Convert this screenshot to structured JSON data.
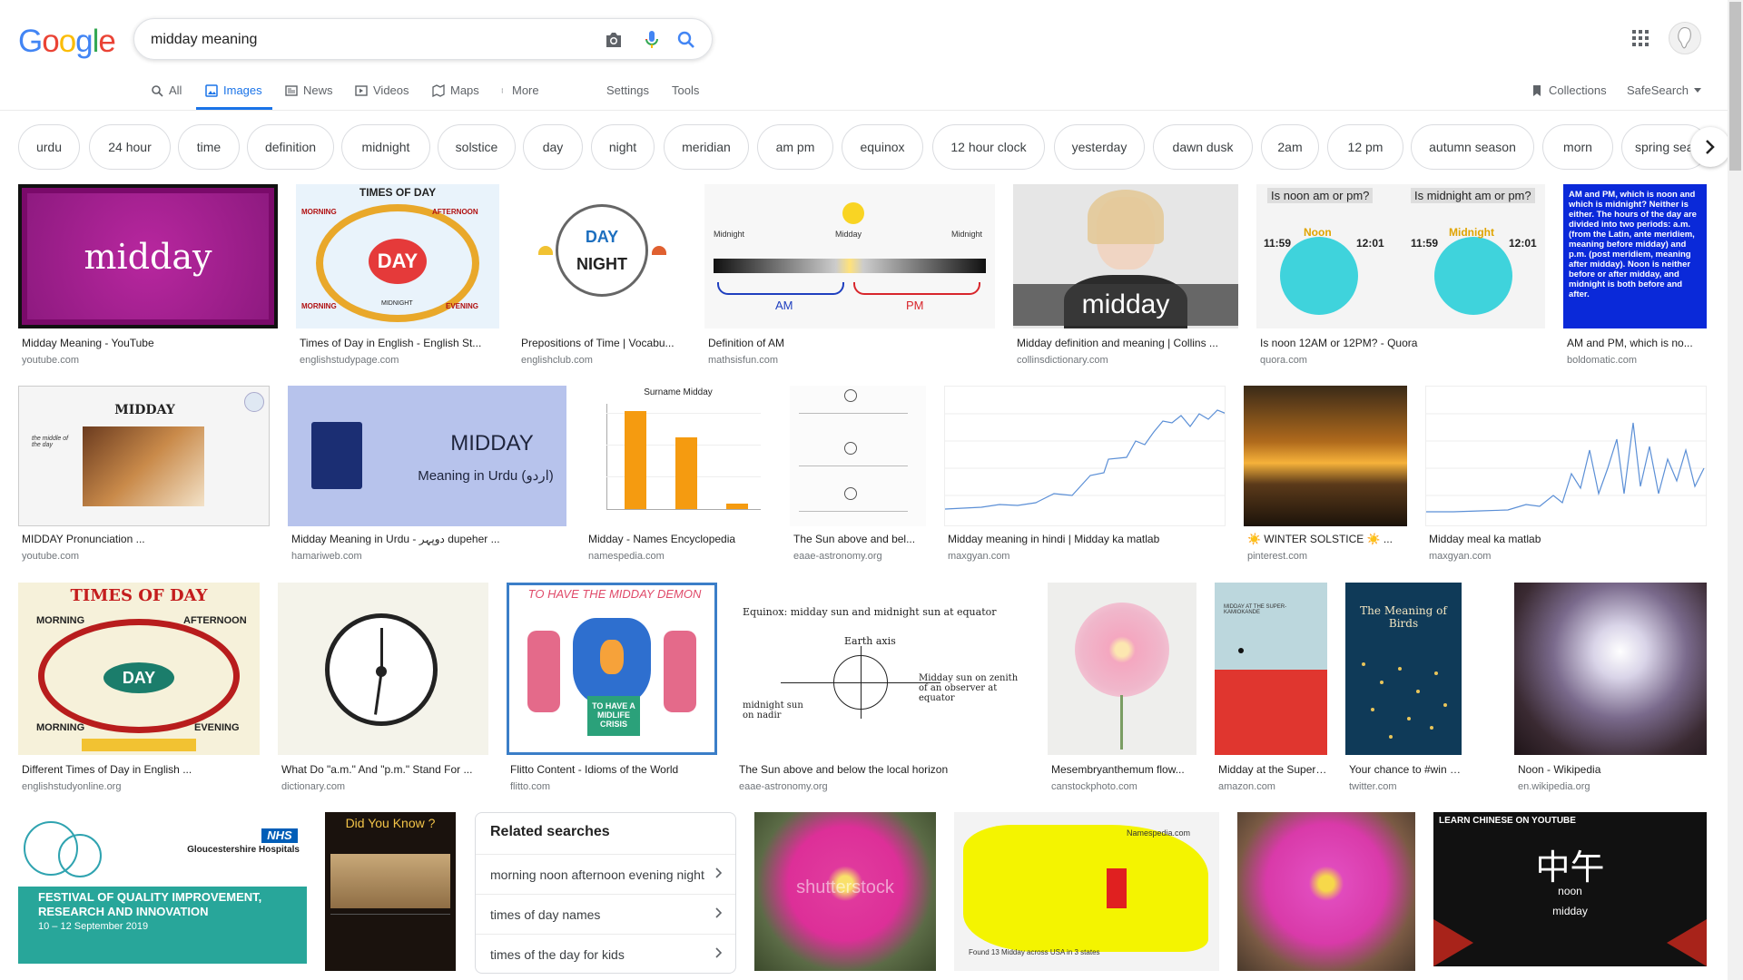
{
  "search": {
    "query": "midday meaning"
  },
  "tabs": {
    "all": "All",
    "images": "Images",
    "news": "News",
    "videos": "Videos",
    "maps": "Maps",
    "more": "More",
    "settings": "Settings",
    "tools": "Tools",
    "collections": "Collections",
    "safesearch": "SafeSearch"
  },
  "chips": [
    "urdu",
    "24 hour",
    "time",
    "definition",
    "midnight",
    "solstice",
    "day",
    "night",
    "meridian",
    "am pm",
    "equinox",
    "12 hour clock",
    "yesterday",
    "dawn dusk",
    "2am",
    "12 pm",
    "autumn season",
    "morn",
    "spring sea"
  ],
  "results": {
    "r1": {
      "caption": "Midday Meaning - YouTube",
      "domain": "youtube.com",
      "img_text": "midday"
    },
    "r2": {
      "caption": "Times of Day in English - English St...",
      "domain": "englishstudypage.com",
      "img_title": "TIMES OF DAY",
      "img_center": "DAY",
      "img_morning": "MORNING",
      "img_afternoon": "AFTERNOON",
      "img_evening": "EVENING",
      "img_night": "MIDNIGHT"
    },
    "r3": {
      "caption": "Prepositions of Time | Vocabu...",
      "domain": "englishclub.com",
      "img_day": "DAY",
      "img_night": "NIGHT"
    },
    "r4": {
      "caption": "Definition of AM",
      "domain": "mathsisfun.com",
      "img_am": "AM",
      "img_pm": "PM",
      "img_midnight": "Midnight",
      "img_midday": "Midday"
    },
    "r5": {
      "caption": "Midday definition and meaning | Collins ...",
      "domain": "collinsdictionary.com",
      "img_text": "midday"
    },
    "r6": {
      "caption": "Is noon 12AM or 12PM? - Quora",
      "domain": "quora.com",
      "img_q1": "Is noon am or pm?",
      "img_q2": "Is midnight am or pm?",
      "img_noon": "Noon",
      "img_midnight": "Midnight",
      "img_t1": "11:59",
      "img_t2": "12:01"
    },
    "r7": {
      "caption": "AM and PM, which is no...",
      "domain": "boldomatic.com",
      "img_text": "AM and PM, which is noon and which is midnight? Neither is either. The hours of the day are divided into two periods: a.m. (from the Latin, ante meridiem, meaning before midday) and p.m. (post meridiem, meaning after midday). Noon is neither before or after midday, and midnight is both before and after."
    },
    "r8": {
      "caption": "MIDDAY Pronunciation ...",
      "domain": "youtube.com",
      "img_title": "MIDDAY",
      "img_sub": "the middle of the day"
    },
    "r9": {
      "caption": "Midday Meaning in Urdu - دوپہر dupeher ...",
      "domain": "hamariweb.com",
      "img_title": "MIDDAY",
      "img_sub": "Meaning in Urdu (اردو)"
    },
    "r10": {
      "caption": "Midday - Names Encyclopedia",
      "domain": "namespedia.com",
      "img_title": "Surname Midday"
    },
    "r11": {
      "caption": "The Sun above and bel...",
      "domain": "eaae-astronomy.org"
    },
    "r12": {
      "caption": "Midday meaning in hindi | Midday ka matlab",
      "domain": "maxgyan.com"
    },
    "r13": {
      "caption": "☀️ WINTER SOLSTICE ☀️ ...",
      "domain": "pinterest.com"
    },
    "r14": {
      "caption": "Midday meal ka matlab",
      "domain": "maxgyan.com"
    },
    "r15": {
      "caption": "Different Times of Day in English ...",
      "domain": "englishstudyonline.org",
      "img_title": "TIMES OF DAY",
      "img_center": "DAY",
      "img_morning": "MORNING",
      "img_afternoon": "AFTERNOON",
      "img_evening": "EVENING"
    },
    "r16": {
      "caption": "What Do \"a.m.\" And \"p.m.\" Stand For ...",
      "domain": "dictionary.com"
    },
    "r17": {
      "caption": "Flitto Content - Idioms of the World",
      "domain": "flitto.com",
      "img_title": "TO HAVE THE MIDDAY DEMON",
      "img_sub": "TO HAVE A MIDLIFE CRISIS"
    },
    "r18": {
      "caption": "The Sun above and below the local horizon",
      "domain": "eaae-astronomy.org",
      "img_title": "Equinox: midday sun and midnight sun at equator",
      "img_axis": "Earth axis",
      "img_left": "midnight sun on nadir",
      "img_right": "Midday sun on zenith of an observer at equator"
    },
    "r19": {
      "caption": "Mesembryanthemum flow...",
      "domain": "canstockphoto.com"
    },
    "r20": {
      "caption": "Midday at the Super-K...",
      "domain": "amazon.com",
      "img_title": "MIDDAY AT THE SUPER-KAMIOKANDE"
    },
    "r21": {
      "caption": "Your chance to #win a...",
      "domain": "twitter.com",
      "img_title": "The Meaning of Birds"
    },
    "r22": {
      "caption": "Noon - Wikipedia",
      "domain": "en.wikipedia.org"
    },
    "r23": {
      "img_title": "FESTIVAL OF QUALITY IMPROVEMENT, RESEARCH AND INNOVATION",
      "img_date": "10 – 12 September 2019",
      "img_org": "Gloucestershire Hospitals",
      "img_nhs": "NHS"
    },
    "r24": {
      "img_title": "Did You Know ?"
    },
    "r25": {
      "img_text": "shutterstock"
    },
    "r26": {
      "img_text": "Namespedia.com",
      "img_sub": "Found 13 Midday across USA in 3 states"
    },
    "r28": {
      "img_title": "LEARN CHINESE ON YOUTUBE",
      "img_cn": "中午",
      "img_noon": "noon",
      "img_midday": "midday"
    }
  },
  "related": {
    "title": "Related searches",
    "items": [
      "morning noon afternoon evening night",
      "times of day names",
      "times of the day for kids"
    ]
  },
  "colors": {
    "accent": "#1a73e8",
    "google_blue": "#4285f4",
    "google_red": "#ea4335",
    "google_yellow": "#fbbc05",
    "google_green": "#34a853"
  }
}
